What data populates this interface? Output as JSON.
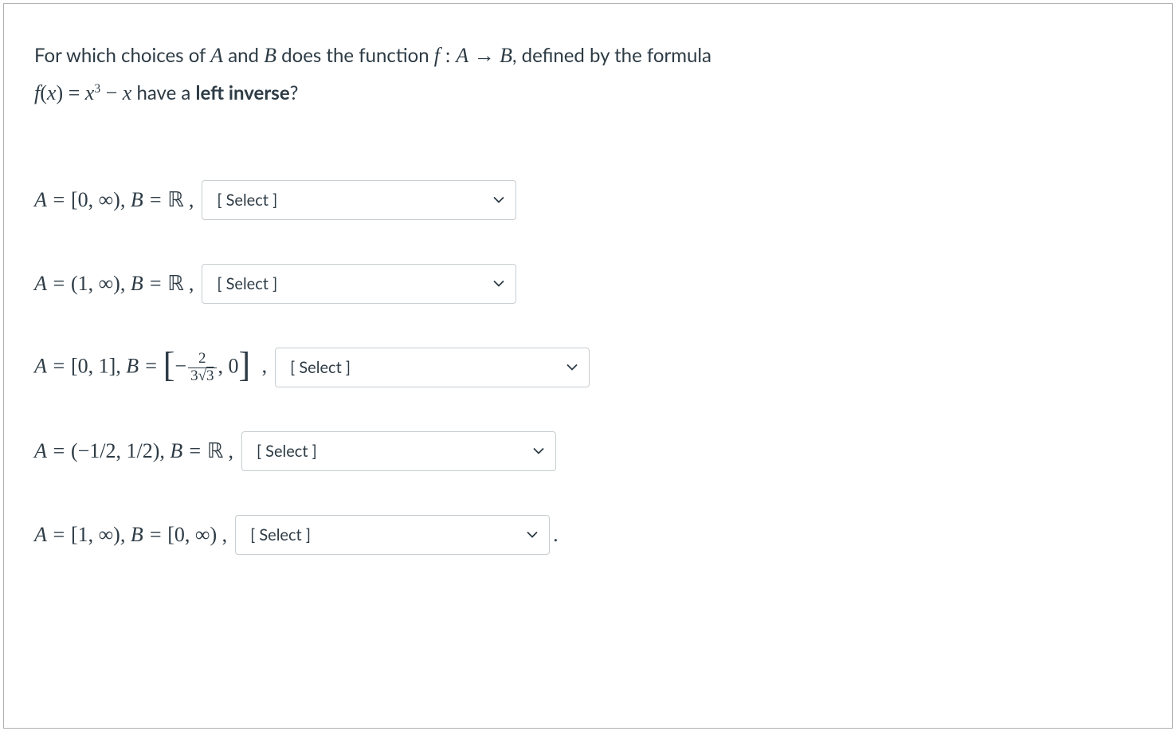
{
  "question": {
    "line1_prefix": "For which choices of ",
    "var_A": "A",
    "and": " and ",
    "var_B": "B",
    "line1_mid": " does the function ",
    "func_f": "f",
    "colon": " : ",
    "arrow": " → ",
    "line1_suffix": ", defined by the formula",
    "line2_lhs_f": "f",
    "line2_lhs_paren": "(x) = ",
    "line2_rhs_x": "x",
    "line2_rhs_exp": "3",
    "line2_rhs_minus": " − ",
    "line2_rhs_x2": "x",
    "line2_text": "  have a ",
    "line2_bold": "left inverse",
    "line2_q": "?"
  },
  "rows": [
    {
      "A_eq": "A = ",
      "A_val": "[0, ∞)",
      "B_eq": ", B = ",
      "B_val": "ℝ",
      "comma": " ,",
      "placeholder": "[ Select ]",
      "trailing": ""
    },
    {
      "A_eq": "A = ",
      "A_val": "(1, ∞)",
      "B_eq": ", B = ",
      "B_val": "ℝ",
      "comma": " ,",
      "placeholder": "[ Select ]",
      "trailing": ""
    },
    {
      "A_eq": "A = ",
      "A_val": "[0, 1]",
      "B_eq": ", B = ",
      "frac_num": "2",
      "frac_den_before": "3",
      "frac_den_sqrt": "3",
      "bracket_open": "[",
      "minus": "−",
      "bracket_sep": ", 0",
      "bracket_close": "]",
      "comma": " ,",
      "placeholder": "[ Select ]",
      "trailing": ""
    },
    {
      "A_eq": "A = ",
      "A_val": "(−1/2, 1/2)",
      "B_eq": ", B = ",
      "B_val": "ℝ",
      "comma": " ,",
      "placeholder": "[ Select ]",
      "trailing": ""
    },
    {
      "A_eq": "A = ",
      "A_val": "[1, ∞)",
      "B_eq": ", B = ",
      "B_val": "[0, ∞)",
      "comma": "  ,",
      "placeholder": "[ Select ]",
      "trailing": "."
    }
  ]
}
